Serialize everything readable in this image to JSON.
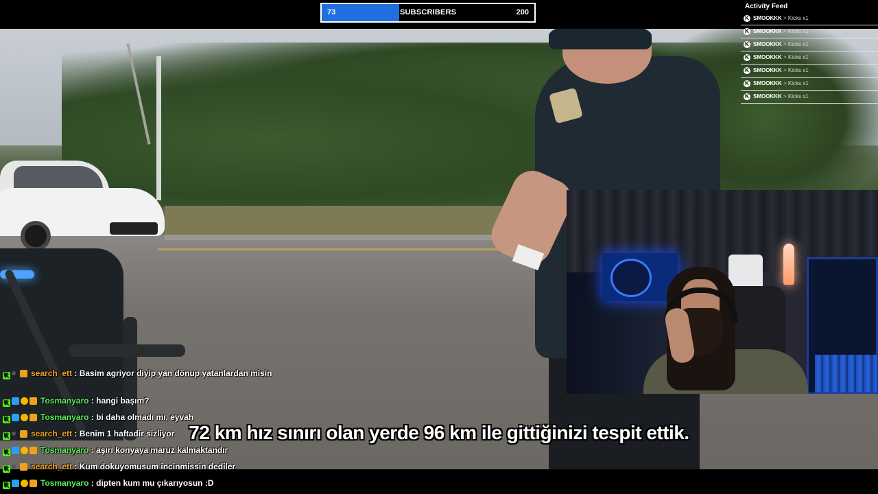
{
  "subscribers": {
    "current": "73",
    "label": "SUBSCRIBERS",
    "goal": "200",
    "progress": 0.365,
    "fill_color": "#1f6fe0"
  },
  "activity_feed": {
    "title": "Activity Feed",
    "items": [
      {
        "name": "SMOOKKK",
        "action": "> Kicks x1"
      },
      {
        "name": "SMOOKKK",
        "action": "> Kicks x1"
      },
      {
        "name": "SMOOKKK",
        "action": "> Kicks x1"
      },
      {
        "name": "SMOOKKK",
        "action": "> Kicks x1"
      },
      {
        "name": "SMOOKKK",
        "action": "> Kicks x1"
      },
      {
        "name": "SMOOKKK",
        "action": "> Kicks x1"
      },
      {
        "name": "SMOOKKK",
        "action": "> Kicks x1"
      }
    ]
  },
  "subtitle": "72 km hız sınırı olan yerde 96 km ile gittiğinizi tespit ettik.",
  "chat": [
    {
      "user": "search_ett",
      "sep": " : ",
      "text": "Basim agriyor diyip yan dönup yatanlardan misin",
      "color": "orange"
    },
    {
      "user": "Tosmanyaro",
      "sep": " : ",
      "text": "hangi başım?",
      "color": "green"
    },
    {
      "user": "Tosmanyaro",
      "sep": " : ",
      "text": "bi daha olmadı mı, eyvah",
      "color": "green"
    },
    {
      "user": "search_ett",
      "sep": " : ",
      "text": "Benim 1 haftadir sizliyor",
      "color": "orange"
    },
    {
      "user": "Tosmanyaro",
      "sep": " : ",
      "text": "aşırı konyaya maruz kalmaktandır",
      "color": "green"
    },
    {
      "user": "search_ett",
      "sep": " : ",
      "text": "Kum dokuyomusum incinmissin dediler",
      "color": "orange"
    },
    {
      "user": "Tosmanyaro",
      "sep": " : ",
      "text": "dipten kum mu çıkarıyosun :D",
      "color": "green"
    }
  ],
  "icons": {
    "kick_badge": "K",
    "feed_icon": "K"
  },
  "colors": {
    "user_green": "#5cf25c",
    "user_orange": "#f0a020",
    "accent_blue": "#1f6fe0"
  }
}
